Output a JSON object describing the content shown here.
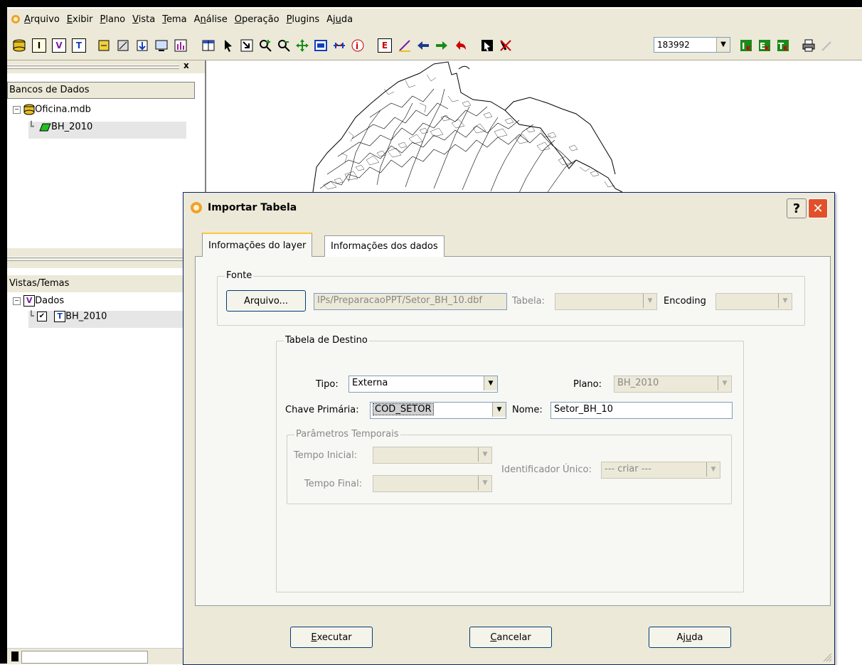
{
  "menu": {
    "items": [
      {
        "pre": "",
        "u": "A",
        "post": "rquivo"
      },
      {
        "pre": "",
        "u": "E",
        "post": "xibir"
      },
      {
        "pre": "",
        "u": "P",
        "post": "lano"
      },
      {
        "pre": "",
        "u": "V",
        "post": "ista"
      },
      {
        "pre": "",
        "u": "T",
        "post": "ema"
      },
      {
        "pre": "A",
        "u": "n",
        "post": "álise"
      },
      {
        "pre": "",
        "u": "O",
        "post": "peração"
      },
      {
        "pre": "",
        "u": "P",
        "post": "lugins"
      },
      {
        "pre": "Aj",
        "u": "u",
        "post": "da"
      }
    ]
  },
  "toolbar": {
    "scale_value": "183992",
    "btn_i": "I",
    "btn_v": "V",
    "btn_t": "T",
    "btn_e": "E"
  },
  "left": {
    "databases_header": "Bancos de Dados",
    "database_name": "Oficina.mdb",
    "layer_name": "BH_2010",
    "views_header": "Vistas/Temas",
    "view_name": "Dados",
    "theme_name": "BH_2010",
    "close_glyph": "x"
  },
  "dialog": {
    "title": "Importar Tabela",
    "help_glyph": "?",
    "close_glyph": "✕",
    "tabs": [
      "Informações do layer",
      "Informações dos dados"
    ],
    "fonte": {
      "legend": "Fonte",
      "arquivo_button": "Arquivo...",
      "file_path": "IPs/PreparacaoPPT/Setor_BH_10.dbf",
      "tabela_label": "Tabela:",
      "tabela_value": "",
      "encoding_label": "Encoding",
      "encoding_value": ""
    },
    "destino": {
      "legend": "Tabela de Destino",
      "tipo_label": "Tipo:",
      "tipo_value": "Externa",
      "plano_label": "Plano:",
      "plano_value": "BH_2010",
      "chave_label": "Chave Primária:",
      "chave_value": "COD_SETOR",
      "nome_label": "Nome:",
      "nome_value": "Setor_BH_10"
    },
    "temporais": {
      "legend": "Parâmetros Temporais",
      "tempo_inicial_label": "Tempo Inicial:",
      "tempo_final_label": "Tempo Final:",
      "identificador_label": "Identificador Único:",
      "identificador_value": "--- criar ---"
    },
    "buttons": {
      "executar_u": "E",
      "executar_rest": "xecutar",
      "cancelar_u": "C",
      "cancelar_rest": "ancelar",
      "ajuda_pre": "Aj",
      "ajuda_u": "u",
      "ajuda_post": "da"
    }
  }
}
